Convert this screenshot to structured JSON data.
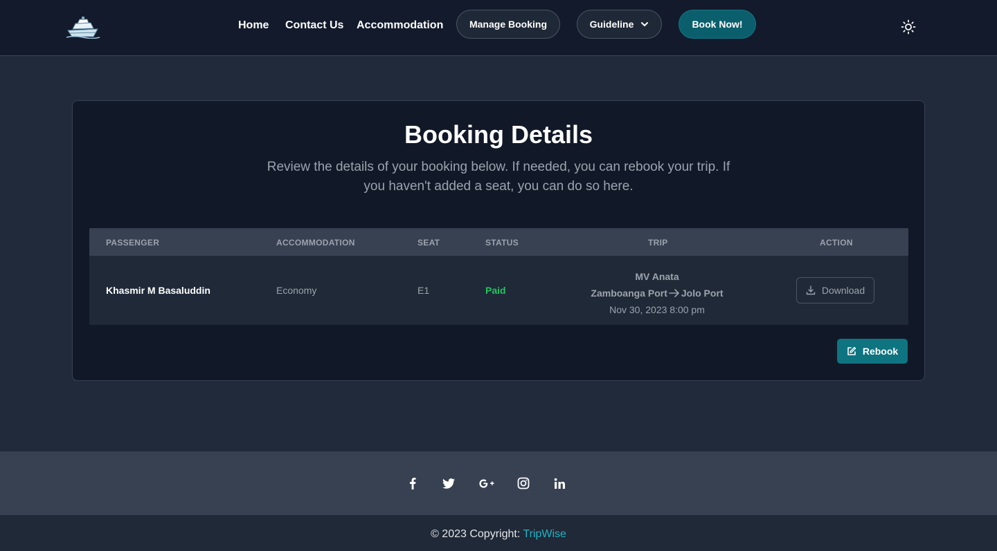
{
  "nav": {
    "links": [
      "Home",
      "Contact Us",
      "Accommodation"
    ],
    "manage_booking": "Manage Booking",
    "guideline": "Guideline",
    "book_now": "Book Now!"
  },
  "card": {
    "title": "Booking Details",
    "subtitle": "Review the details of your booking below. If needed, you can rebook your trip. If you haven't added a seat, you can do so here."
  },
  "table": {
    "headers": [
      "PASSENGER",
      "ACCOMMODATION",
      "SEAT",
      "STATUS",
      "TRIP",
      "ACTION"
    ],
    "row": {
      "passenger": "Khasmir M Basaluddin",
      "accommodation": "Economy",
      "seat": "E1",
      "status": "Paid",
      "trip_vessel": "MV Anata",
      "trip_origin": "Zamboanga Port",
      "trip_destination": "Jolo Port",
      "trip_datetime": "Nov 30, 2023 8:00 pm",
      "action": "Download"
    }
  },
  "rebook_label": "Rebook",
  "footer": {
    "social_icons": [
      "facebook-icon",
      "twitter-icon",
      "google-plus-icon",
      "instagram-icon",
      "linkedin-icon"
    ],
    "copyright_prefix": "© 2023 Copyright:",
    "brand": "TripWise"
  },
  "colors": {
    "accent": "#0e7480",
    "status_paid": "#22c55e",
    "brand_link": "#22b3c7"
  }
}
